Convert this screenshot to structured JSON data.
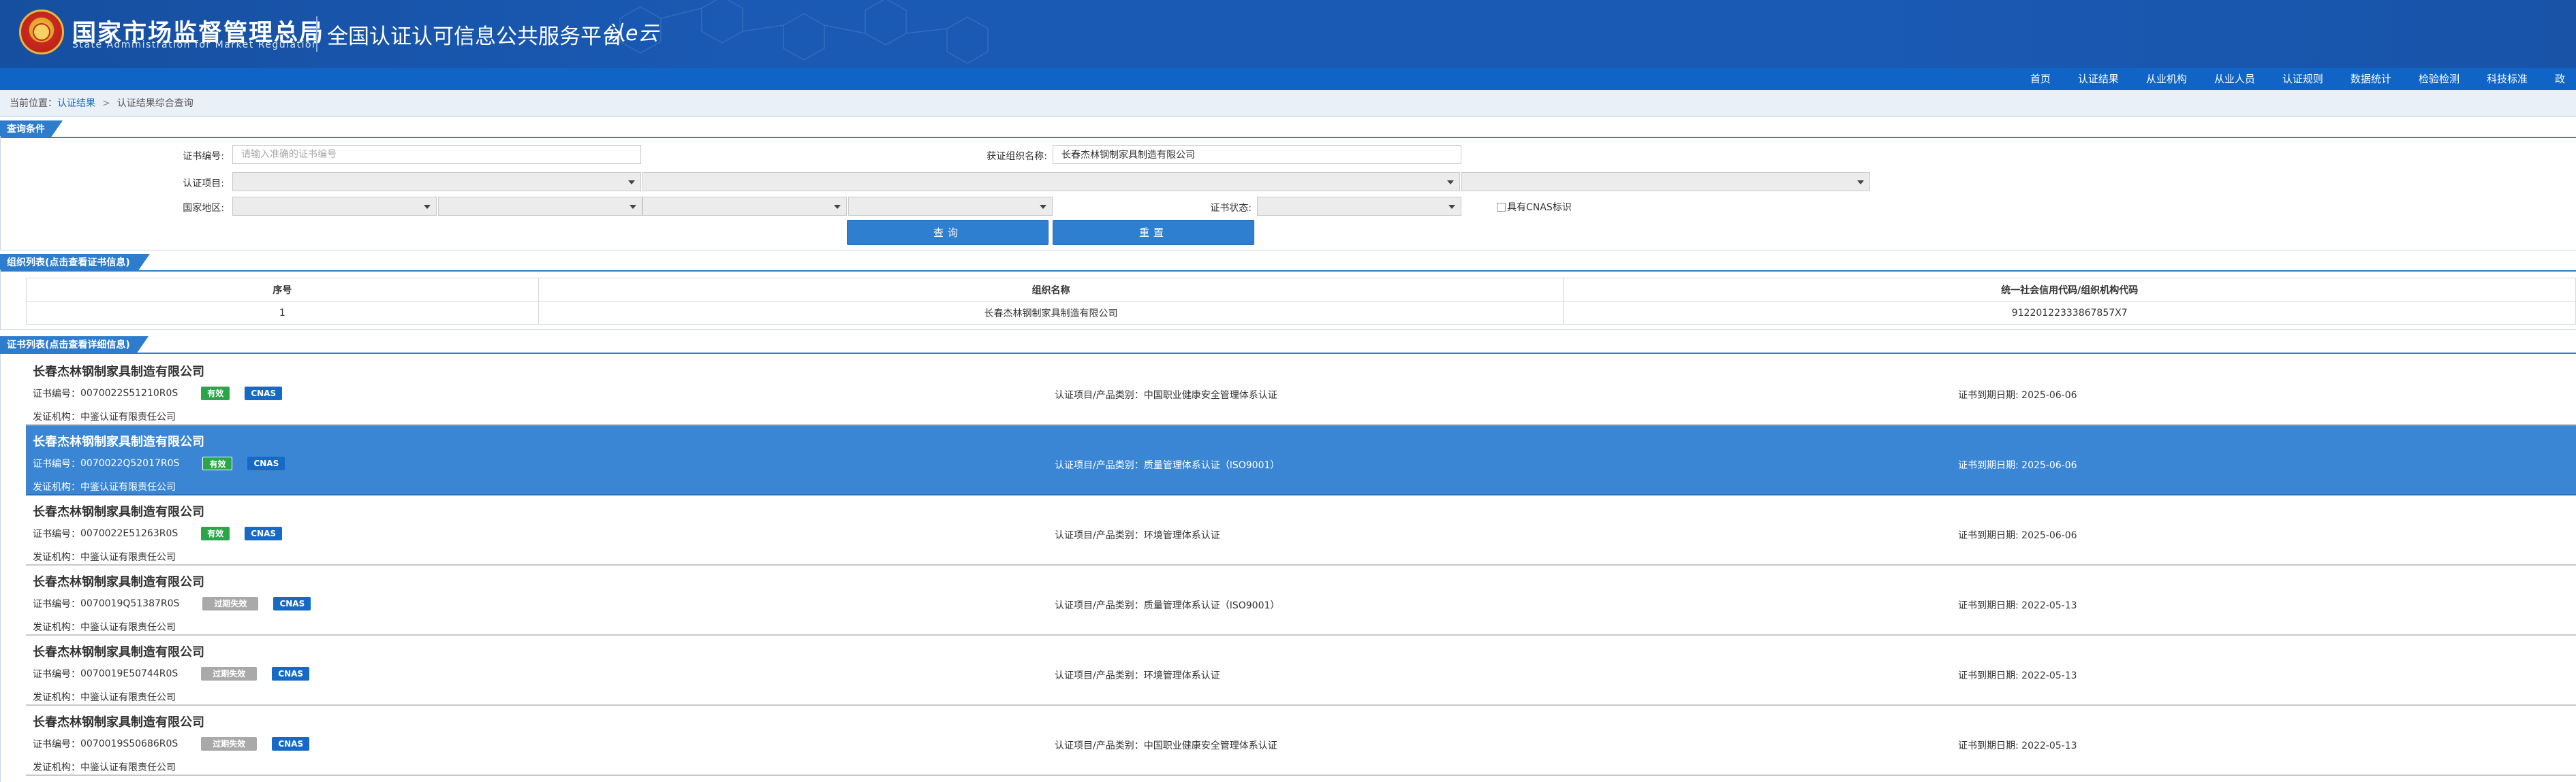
{
  "header": {
    "brand_cn": "国家市场监督管理总局",
    "brand_en": "State Administration for Market Regulation",
    "platform_title": "全国认证认可信息公共服务平台",
    "platform_logo": "认e云"
  },
  "nav": {
    "items": [
      "首页",
      "认证结果",
      "从业机构",
      "从业人员",
      "认证规则",
      "数据统计",
      "检验检测",
      "科技标准",
      "政"
    ]
  },
  "breadcrumb": {
    "prefix": "当前位置：",
    "crumb1": "认证结果",
    "separator": ">",
    "crumb2": "认证结果综合查询"
  },
  "query": {
    "section_title": "查询条件",
    "cert_no_label": "证书编号:",
    "cert_no_placeholder": "请输入准确的证书编号",
    "org_name_label": "获证组织名称:",
    "org_name_value": "长春杰林钢制家具制造有限公司",
    "cert_item_label": "认证项目:",
    "region_label": "国家地区:",
    "cert_status_label": "证书状态:",
    "cnas_label": "具有CNAS标识",
    "search_button": "查询",
    "reset_button": "重置"
  },
  "org_list": {
    "section_title": "组织列表(点击查看证书信息)",
    "columns": [
      "序号",
      "组织名称",
      "统一社会信用代码/组织机构代码"
    ],
    "rows": [
      [
        "1",
        "长春杰林钢制家具制造有限公司",
        "91220122333867857X7"
      ]
    ]
  },
  "cert_list": {
    "section_title": "证书列表(点击查看详细信息)",
    "cert_no_prefix": "证书编号：",
    "issuer_prefix": "发证机构：",
    "item_prefix": "认证项目/产品类别：",
    "expire_prefix": "证书到期日期: ",
    "cnas_badge": "CNAS",
    "items": [
      {
        "org": "长春杰林钢制家具制造有限公司",
        "cert_no": "0070022S51210R0S",
        "status": "有效",
        "issuer": "中鉴认证有限责任公司",
        "item": "中国职业健康安全管理体系认证",
        "expire": "2025-06-06"
      },
      {
        "org": "长春杰林钢制家具制造有限公司",
        "cert_no": "0070022Q52017R0S",
        "status": "有效",
        "issuer": "中鉴认证有限责任公司",
        "item": "质量管理体系认证（ISO9001）",
        "expire": "2025-06-06"
      },
      {
        "org": "长春杰林钢制家具制造有限公司",
        "cert_no": "0070022E51263R0S",
        "status": "有效",
        "issuer": "中鉴认证有限责任公司",
        "item": "环境管理体系认证",
        "expire": "2025-06-06"
      },
      {
        "org": "长春杰林钢制家具制造有限公司",
        "cert_no": "0070019Q51387R0S",
        "status": "过期失效",
        "issuer": "中鉴认证有限责任公司",
        "item": "质量管理体系认证（ISO9001）",
        "expire": "2022-05-13"
      },
      {
        "org": "长春杰林钢制家具制造有限公司",
        "cert_no": "0070019E50744R0S",
        "status": "过期失效",
        "issuer": "中鉴认证有限责任公司",
        "item": "环境管理体系认证",
        "expire": "2022-05-13"
      },
      {
        "org": "长春杰林钢制家具制造有限公司",
        "cert_no": "0070019S50686R0S",
        "status": "过期失效",
        "issuer": "中鉴认证有限责任公司",
        "item": "中国职业健康安全管理体系认证",
        "expire": "2022-05-13"
      }
    ]
  }
}
